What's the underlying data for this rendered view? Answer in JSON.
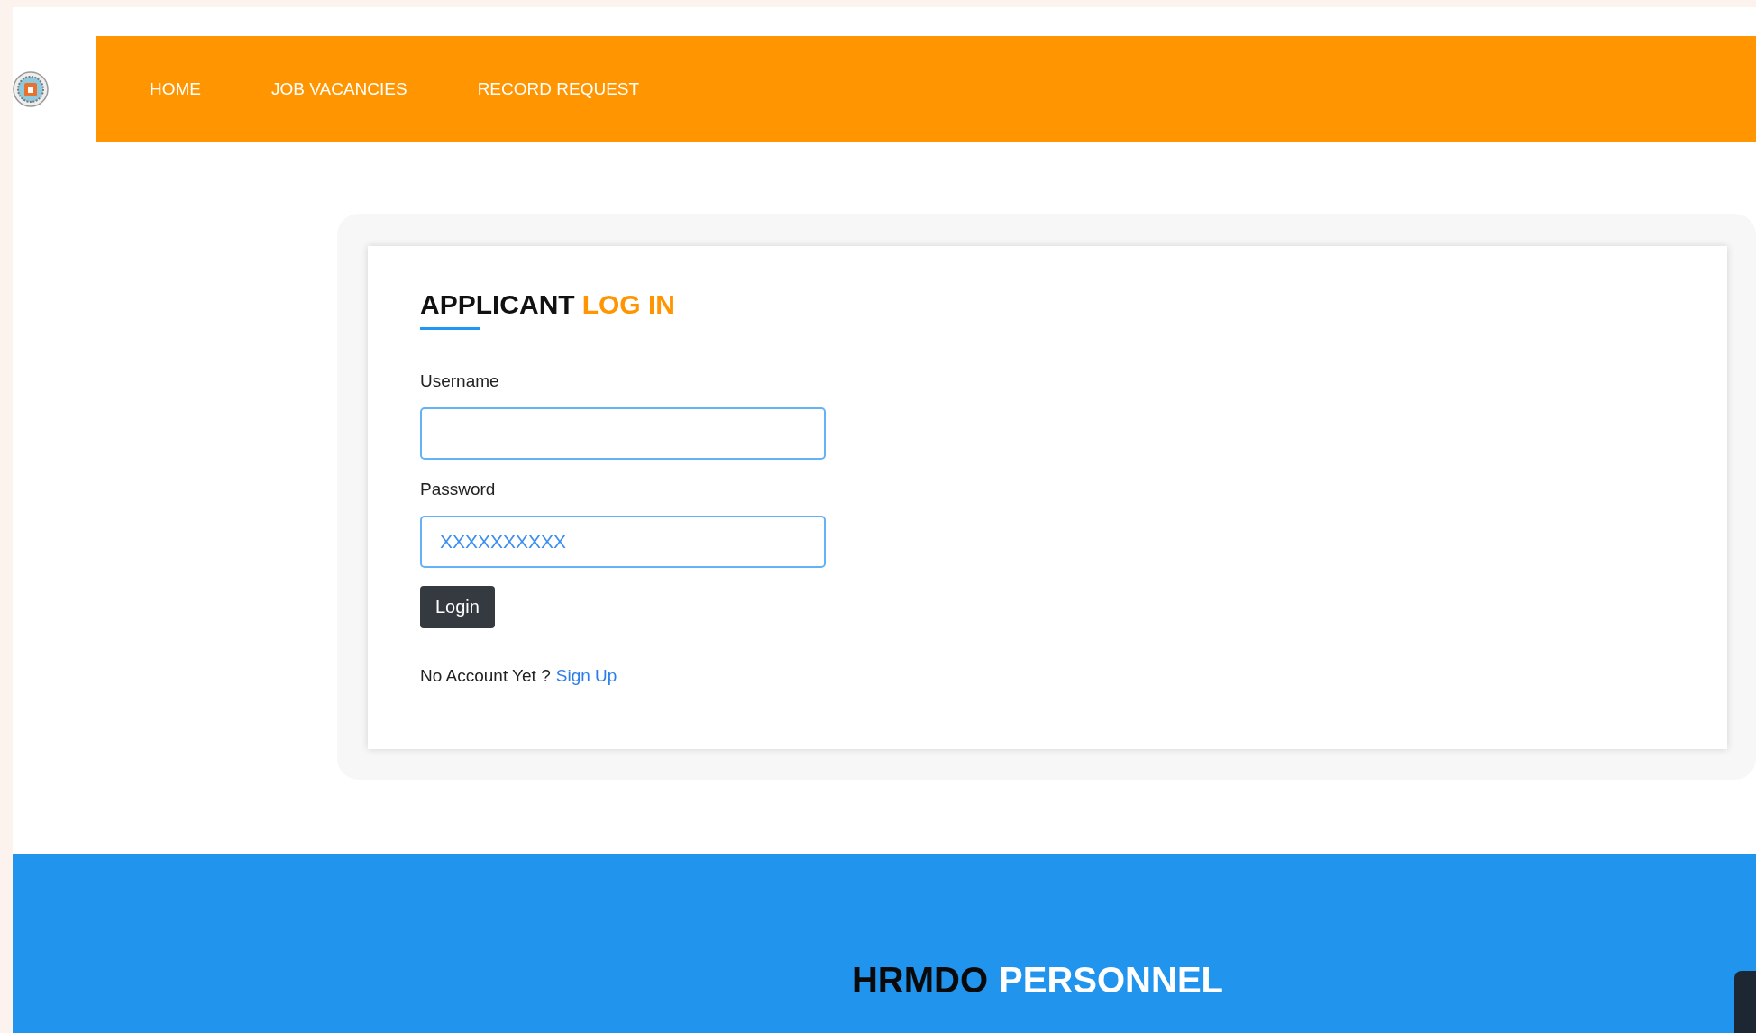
{
  "nav": {
    "items": [
      {
        "label": "HOME"
      },
      {
        "label": "JOB VACANCIES"
      },
      {
        "label": "RECORD REQUEST"
      }
    ]
  },
  "login": {
    "title_dark": "APPLICANT",
    "title_accent": "LOG IN",
    "fields": [
      {
        "label": "Username"
      },
      {
        "label": "Password",
        "value": "XXXXXXXXXX"
      }
    ],
    "button": "Login",
    "signup_text": "No Account Yet ?",
    "signup_link": "Sign Up"
  },
  "footer": {
    "title_dark": "HRMDO",
    "title_light": "PERSONNEL"
  }
}
